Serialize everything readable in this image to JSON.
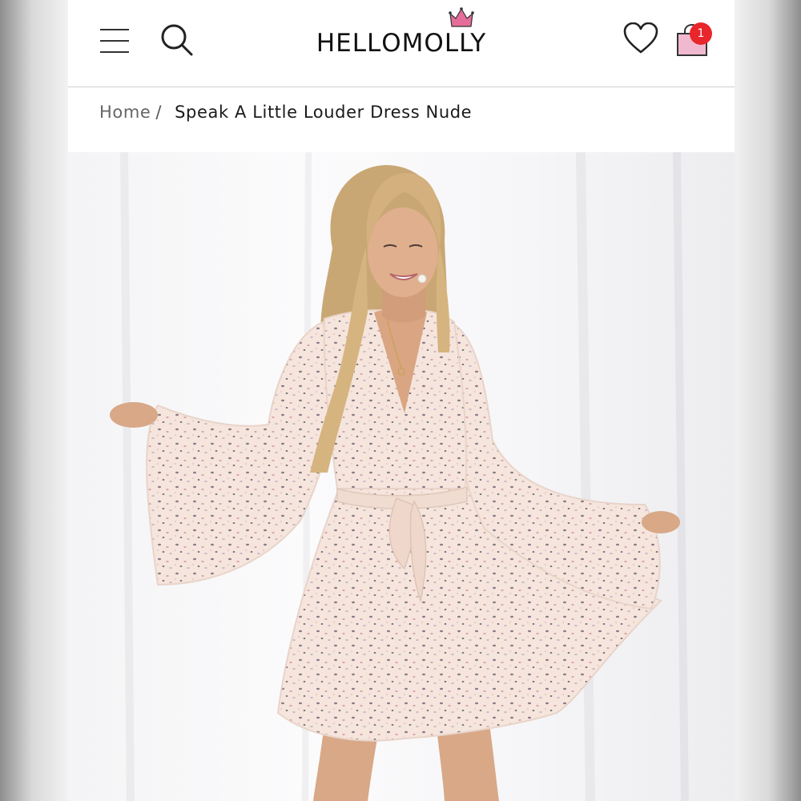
{
  "header": {
    "menu_icon": "hamburger-menu-icon",
    "search_icon": "search-icon",
    "logo": {
      "text_left": "HELL",
      "text_mid": "O",
      "text_right": "MOLLY"
    },
    "wishlist_icon": "heart-icon",
    "cart": {
      "icon": "shopping-bag-icon",
      "count": "1"
    }
  },
  "breadcrumb": {
    "home": "Home",
    "separator": "/",
    "current": "Speak A Little Louder Dress Nude"
  },
  "colors": {
    "badge": "#e8262b",
    "crown": "#e46d9a",
    "bag": "#f1b9cf",
    "dress": "#f5e5dc"
  }
}
